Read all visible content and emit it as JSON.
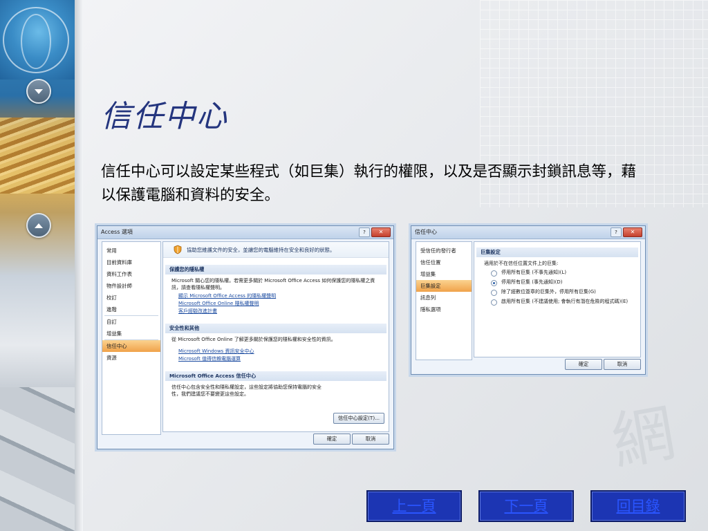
{
  "slide": {
    "title": "信任中心",
    "description": "信任中心可以設定某些程式（如巨集）執行的權限，以及是否顯示封鎖訊息等，藉以保護電腦和資料的安全。"
  },
  "access_dialog": {
    "title": "Access 選項",
    "help": "?",
    "close": "✕",
    "sidebar": [
      "常用",
      "目前資料庫",
      "資料工作表",
      "物件設計師",
      "校訂",
      "進階",
      "自訂",
      "增益集",
      "信任中心",
      "資源"
    ],
    "selected": "信任中心",
    "banner": "協助您維護文件的安全，並讓您的電腦維持在安全和良好的狀態。",
    "privacy": {
      "header": "保護您的隱私權",
      "text": "Microsoft 關心您的隱私權。若需更多關於 Microsoft Office Access 如何保護您的隱私權之資訊，請查看隱私權聲明。",
      "links": [
        "顯示 Microsoft Office Access 的隱私權聲明",
        "Microsoft Office Online 隱私權聲明",
        "客戶經驗改進計畫"
      ]
    },
    "security": {
      "header": "安全性和其他",
      "text": "從 Microsoft Office Online 了解更多關於保護您的隱私權和安全性的資訊。",
      "links": [
        "Microsoft Windows 資訊安全中心",
        "Microsoft 值得信賴電腦運算"
      ]
    },
    "trust_center": {
      "header": "Microsoft Office Access 信任中心",
      "text": "信任中心包含安全性和隱私權設定，這些設定將協助您保持電腦的安全性，我們建議您不要變更這些設定。",
      "button": "信任中心設定(T)..."
    },
    "ok": "確定",
    "cancel": "取消"
  },
  "trust_dialog": {
    "title": "信任中心",
    "help": "?",
    "close": "✕",
    "sidebar": [
      "受信任的發行者",
      "信任位置",
      "增益集",
      "巨集設定",
      "訊息列",
      "隱私選項"
    ],
    "selected": "巨集設定",
    "header": "巨集設定",
    "intro": "適用於不在信任位置文件上的巨集:",
    "options": [
      {
        "label": "停用所有巨集 (不事先通知)(L)",
        "selected": false
      },
      {
        "label": "停用所有巨集 (事先通知)(D)",
        "selected": true
      },
      {
        "label": "除了經數位簽章的巨集外，停用所有巨集(G)",
        "selected": false
      },
      {
        "label": "啟用所有巨集 (不建議使用; 會執行有潛在危險的程式碼)(E)",
        "selected": false
      }
    ],
    "ok": "確定",
    "cancel": "取消"
  },
  "nav": {
    "prev": "上一頁",
    "next": "下一頁",
    "toc": "回目錄"
  }
}
